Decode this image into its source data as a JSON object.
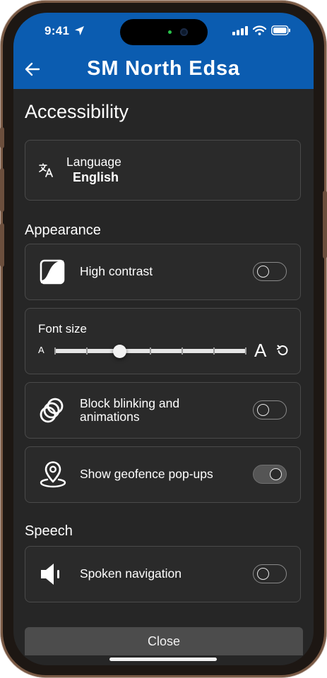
{
  "status_bar": {
    "time": "9:41"
  },
  "header": {
    "title": "SM North Edsa"
  },
  "page": {
    "title": "Accessibility"
  },
  "language": {
    "label": "Language",
    "value": "English"
  },
  "appearance": {
    "heading": "Appearance",
    "high_contrast": {
      "label": "High contrast",
      "enabled": false
    },
    "font_size": {
      "label": "Font size",
      "small_glyph": "A",
      "large_glyph": "A",
      "level": 0.3,
      "steps": 7
    },
    "block_blinking": {
      "label_line1": "Block blinking and",
      "label_line2": "animations",
      "enabled": false
    },
    "geofence": {
      "label": "Show geofence pop-ups",
      "enabled": true
    }
  },
  "speech": {
    "heading": "Speech",
    "spoken_navigation": {
      "label": "Spoken navigation",
      "enabled": false
    }
  },
  "footer": {
    "close_label": "Close"
  },
  "colors": {
    "header_blue": "#0b5cb0",
    "background": "#262626",
    "card": "#2a2a2a"
  }
}
